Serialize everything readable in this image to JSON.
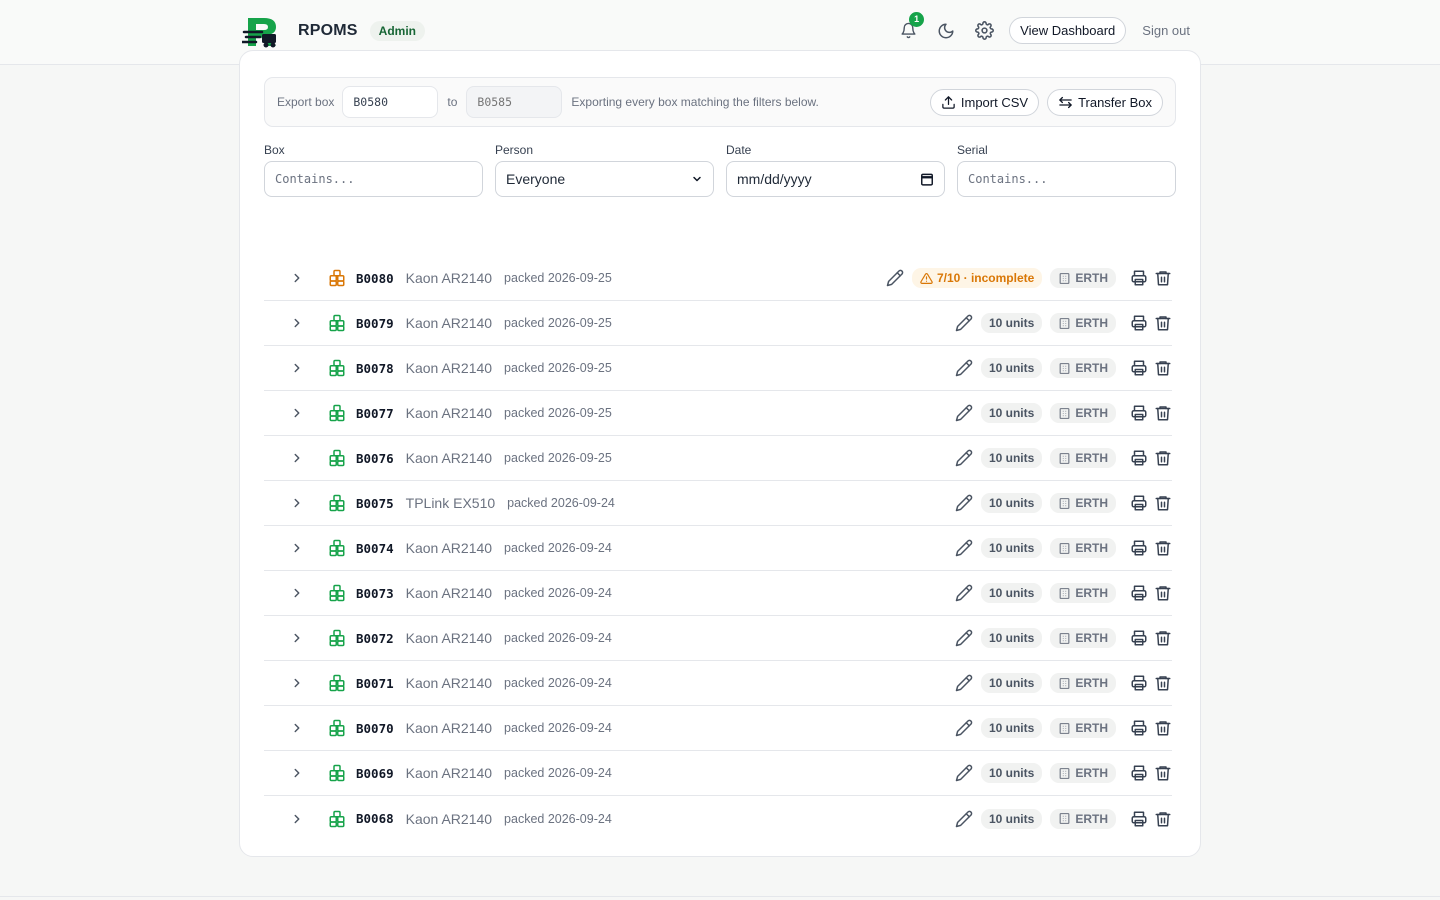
{
  "app": {
    "name": "RPOMS",
    "role": "Admin"
  },
  "header": {
    "notification_count": "1",
    "dashboard_label": "View Dashboard",
    "signout_label": "Sign out"
  },
  "export": {
    "label": "Export box",
    "from_value": "B0580",
    "to_label": "to",
    "to_placeholder": "B0585",
    "hint": "Exporting every box matching the filters below.",
    "import_label": "Import CSV",
    "transfer_label": "Transfer Box"
  },
  "filters": {
    "box": {
      "label": "Box",
      "placeholder": "Contains..."
    },
    "person": {
      "label": "Person",
      "value": "Everyone"
    },
    "date": {
      "label": "Date",
      "placeholder": "mm/dd/yyyy"
    },
    "serial": {
      "label": "Serial",
      "placeholder": "Contains..."
    }
  },
  "colors": {
    "accent": "#16a34a",
    "warning": "#d97706"
  },
  "boxes": [
    {
      "id": "B0080",
      "model": "Kaon AR2140",
      "packed": "packed 2026-09-25",
      "count": "7/10 · incomplete",
      "status": "incomplete",
      "location": "ERTH"
    },
    {
      "id": "B0079",
      "model": "Kaon AR2140",
      "packed": "packed 2026-09-25",
      "count": "10 units",
      "status": "complete",
      "location": "ERTH"
    },
    {
      "id": "B0078",
      "model": "Kaon AR2140",
      "packed": "packed 2026-09-25",
      "count": "10 units",
      "status": "complete",
      "location": "ERTH"
    },
    {
      "id": "B0077",
      "model": "Kaon AR2140",
      "packed": "packed 2026-09-25",
      "count": "10 units",
      "status": "complete",
      "location": "ERTH"
    },
    {
      "id": "B0076",
      "model": "Kaon AR2140",
      "packed": "packed 2026-09-25",
      "count": "10 units",
      "status": "complete",
      "location": "ERTH"
    },
    {
      "id": "B0075",
      "model": "TPLink EX510",
      "packed": "packed 2026-09-24",
      "count": "10 units",
      "status": "complete",
      "location": "ERTH"
    },
    {
      "id": "B0074",
      "model": "Kaon AR2140",
      "packed": "packed 2026-09-24",
      "count": "10 units",
      "status": "complete",
      "location": "ERTH"
    },
    {
      "id": "B0073",
      "model": "Kaon AR2140",
      "packed": "packed 2026-09-24",
      "count": "10 units",
      "status": "complete",
      "location": "ERTH"
    },
    {
      "id": "B0072",
      "model": "Kaon AR2140",
      "packed": "packed 2026-09-24",
      "count": "10 units",
      "status": "complete",
      "location": "ERTH"
    },
    {
      "id": "B0071",
      "model": "Kaon AR2140",
      "packed": "packed 2026-09-24",
      "count": "10 units",
      "status": "complete",
      "location": "ERTH"
    },
    {
      "id": "B0070",
      "model": "Kaon AR2140",
      "packed": "packed 2026-09-24",
      "count": "10 units",
      "status": "complete",
      "location": "ERTH"
    },
    {
      "id": "B0069",
      "model": "Kaon AR2140",
      "packed": "packed 2026-09-24",
      "count": "10 units",
      "status": "complete",
      "location": "ERTH"
    },
    {
      "id": "B0068",
      "model": "Kaon AR2140",
      "packed": "packed 2026-09-24",
      "count": "10 units",
      "status": "complete",
      "location": "ERTH"
    }
  ]
}
